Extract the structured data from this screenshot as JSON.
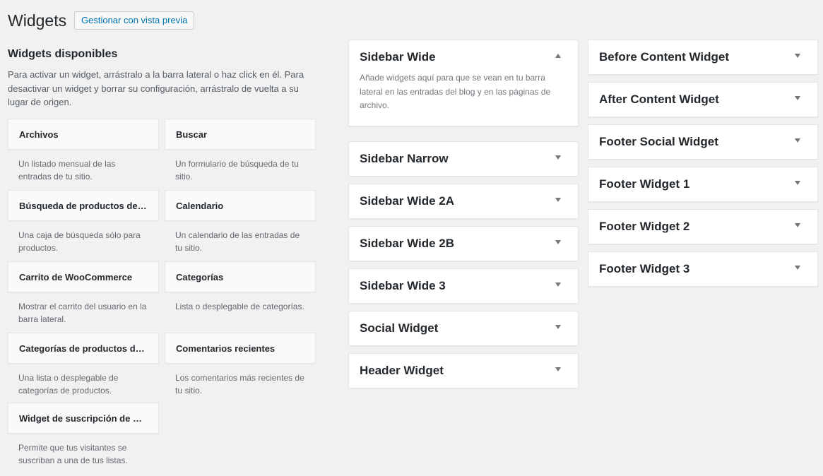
{
  "header": {
    "title": "Widgets",
    "manage_button": "Gestionar con vista previa"
  },
  "available": {
    "title": "Widgets disponibles",
    "description": "Para activar un widget, arrástralo a la barra lateral o haz click en él. Para desactivar un widget y borrar su configuración, arrástralo de vuelta a su lugar de origen.",
    "widgets": [
      {
        "title": "Archivos",
        "description": "Un listado mensual de las entradas de tu sitio."
      },
      {
        "title": "Buscar",
        "description": "Un formulario de búsqueda de tu sitio."
      },
      {
        "title": "Búsqueda de productos de ...",
        "description": "Una caja de búsqueda sólo para productos."
      },
      {
        "title": "Calendario",
        "description": "Un calendario de las entradas de tu sitio."
      },
      {
        "title": "Carrito de WooCommerce",
        "description": "Mostrar el carrito del usuario en la barra lateral."
      },
      {
        "title": "Categorías",
        "description": "Lista o desplegable de categorías."
      },
      {
        "title": "Categorías de productos de ...",
        "description": "Una lista o desplegable de categorías de productos."
      },
      {
        "title": "Comentarios recientes",
        "description": "Los comentarios más recientes de tu sitio."
      },
      {
        "title": "Widget de suscripción de M...",
        "description": "Permite que tus visitantes se suscriban a una de tus listas."
      }
    ]
  },
  "sidebars_left": [
    {
      "name": "Sidebar Wide",
      "expanded": true,
      "description": "Añade widgets aquí para que se vean en tu barra lateral en las entradas del blog y en las páginas de archivo."
    },
    {
      "name": "Sidebar Narrow",
      "expanded": false
    },
    {
      "name": "Sidebar Wide 2A",
      "expanded": false
    },
    {
      "name": "Sidebar Wide 2B",
      "expanded": false
    },
    {
      "name": "Sidebar Wide 3",
      "expanded": false
    },
    {
      "name": "Social Widget",
      "expanded": false
    },
    {
      "name": "Header Widget",
      "expanded": false
    }
  ],
  "sidebars_right": [
    {
      "name": "Before Content Widget",
      "expanded": false
    },
    {
      "name": "After Content Widget",
      "expanded": false
    },
    {
      "name": "Footer Social Widget",
      "expanded": false
    },
    {
      "name": "Footer Widget 1",
      "expanded": false
    },
    {
      "name": "Footer Widget 2",
      "expanded": false
    },
    {
      "name": "Footer Widget 3",
      "expanded": false
    }
  ],
  "icons": {
    "collapse": "arrow-up-icon",
    "expand": "arrow-down-icon"
  },
  "colors": {
    "background": "#f1f1f1",
    "link": "#0073aa",
    "text": "#23282d",
    "muted": "#646970"
  }
}
